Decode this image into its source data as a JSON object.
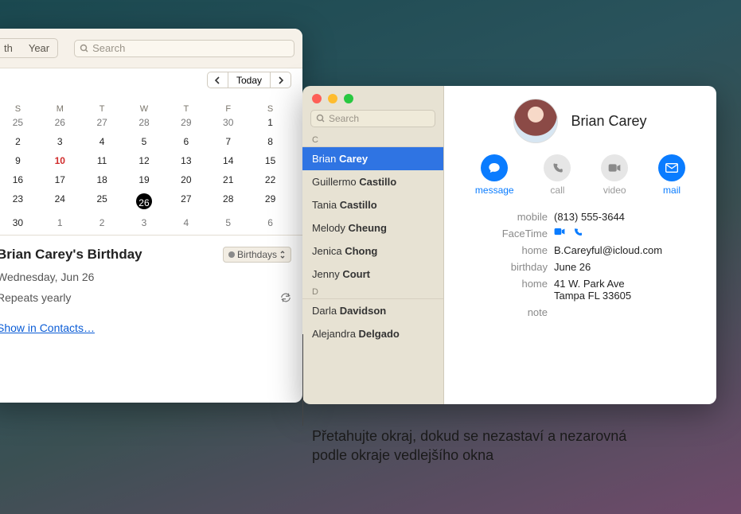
{
  "calendar": {
    "view_tabs": {
      "month": "th",
      "year": "Year"
    },
    "search_placeholder": "Search",
    "today_label": "Today",
    "dow": [
      "S",
      "M",
      "T",
      "W",
      "T",
      "F",
      "S"
    ],
    "grid": [
      [
        "25",
        "26",
        "27",
        "28",
        "29",
        "30",
        "1"
      ],
      [
        "2",
        "3",
        "4",
        "5",
        "6",
        "7",
        "8"
      ],
      [
        "9",
        "10",
        "11",
        "12",
        "13",
        "14",
        "15"
      ],
      [
        "16",
        "17",
        "18",
        "19",
        "20",
        "21",
        "22"
      ],
      [
        "23",
        "24",
        "25",
        "26",
        "27",
        "28",
        "29"
      ],
      [
        "30",
        "1",
        "2",
        "3",
        "4",
        "5",
        "6"
      ]
    ],
    "selected": "26",
    "red_day": "10",
    "event": {
      "title": "Brian Carey's Birthday",
      "calendar_select": "Birthdays",
      "date": "Wednesday, Jun 26",
      "repeat": "Repeats yearly",
      "show_link": "Show in Contacts…"
    }
  },
  "contacts": {
    "search_placeholder": "Search",
    "sections": [
      {
        "letter": "C",
        "items": [
          {
            "first": "Brian",
            "last": "Carey",
            "selected": true
          },
          {
            "first": "Guillermo",
            "last": "Castillo"
          },
          {
            "first": "Tania",
            "last": "Castillo"
          },
          {
            "first": "Melody",
            "last": "Cheung"
          },
          {
            "first": "Jenica",
            "last": "Chong"
          },
          {
            "first": "Jenny",
            "last": "Court"
          }
        ]
      },
      {
        "letter": "D",
        "items": [
          {
            "first": "Darla",
            "last": "Davidson"
          },
          {
            "first": "Alejandra",
            "last": "Delgado"
          }
        ]
      }
    ],
    "detail": {
      "name": "Brian Carey",
      "actions": {
        "message": "message",
        "call": "call",
        "video": "video",
        "mail": "mail"
      },
      "fields": {
        "mobile_label": "mobile",
        "mobile": "(813) 555-3644",
        "facetime_label": "FaceTime",
        "home_email_label": "home",
        "home_email": "B.Careyful@icloud.com",
        "birthday_label": "birthday",
        "birthday": "June 26",
        "home_addr_label": "home",
        "home_addr_l1": "41 W. Park Ave",
        "home_addr_l2": "Tampa FL 33605",
        "note_label": "note"
      }
    }
  },
  "callout": "Přetahujte okraj, dokud se nezastaví a nezarovná podle okraje vedlejšího okna"
}
